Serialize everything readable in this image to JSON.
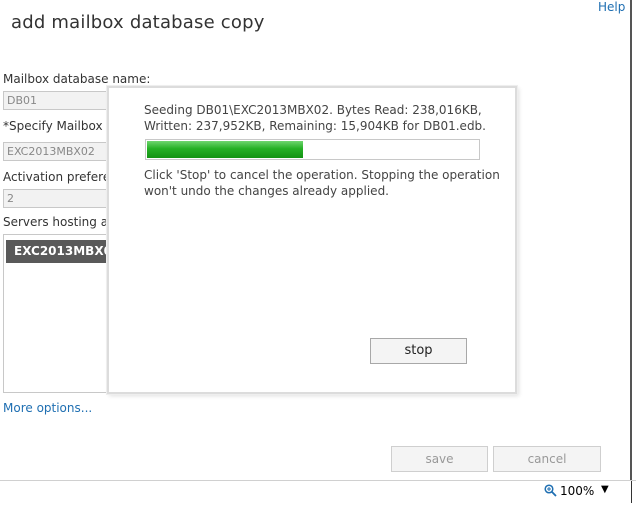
{
  "header": {
    "title": "add mailbox database copy",
    "help_label": "Help"
  },
  "form": {
    "db_name_label": "Mailbox database name:",
    "db_name_value": "DB01",
    "server_label": "*Specify Mailbox se",
    "server_value": "EXC2013MBX02",
    "activation_label": "Activation preferenc",
    "activation_value": "2",
    "servers_hosting_label": "Servers hosting a co",
    "servers_hosting_items": [
      "EXC2013MBX01"
    ],
    "more_options_label": "More options..."
  },
  "modal": {
    "status_line1": "Seeding DB01\\EXC2013MBX02. Bytes Read: 238,016KB,",
    "status_line2": "Written: 237,952KB, Remaining: 15,904KB for DB01.edb.",
    "progress_fraction": 0.47,
    "info_line1": "Click 'Stop' to cancel the operation. Stopping the operation",
    "info_line2": "won't undo the changes already applied.",
    "stop_label": "stop",
    "progress_color": "#25b025"
  },
  "footer": {
    "save_label": "save",
    "cancel_label": "cancel"
  },
  "statusbar": {
    "zoom_icon": "zoom-icon",
    "zoom_level": "100%",
    "caret_icon": "chevron-down-icon"
  }
}
